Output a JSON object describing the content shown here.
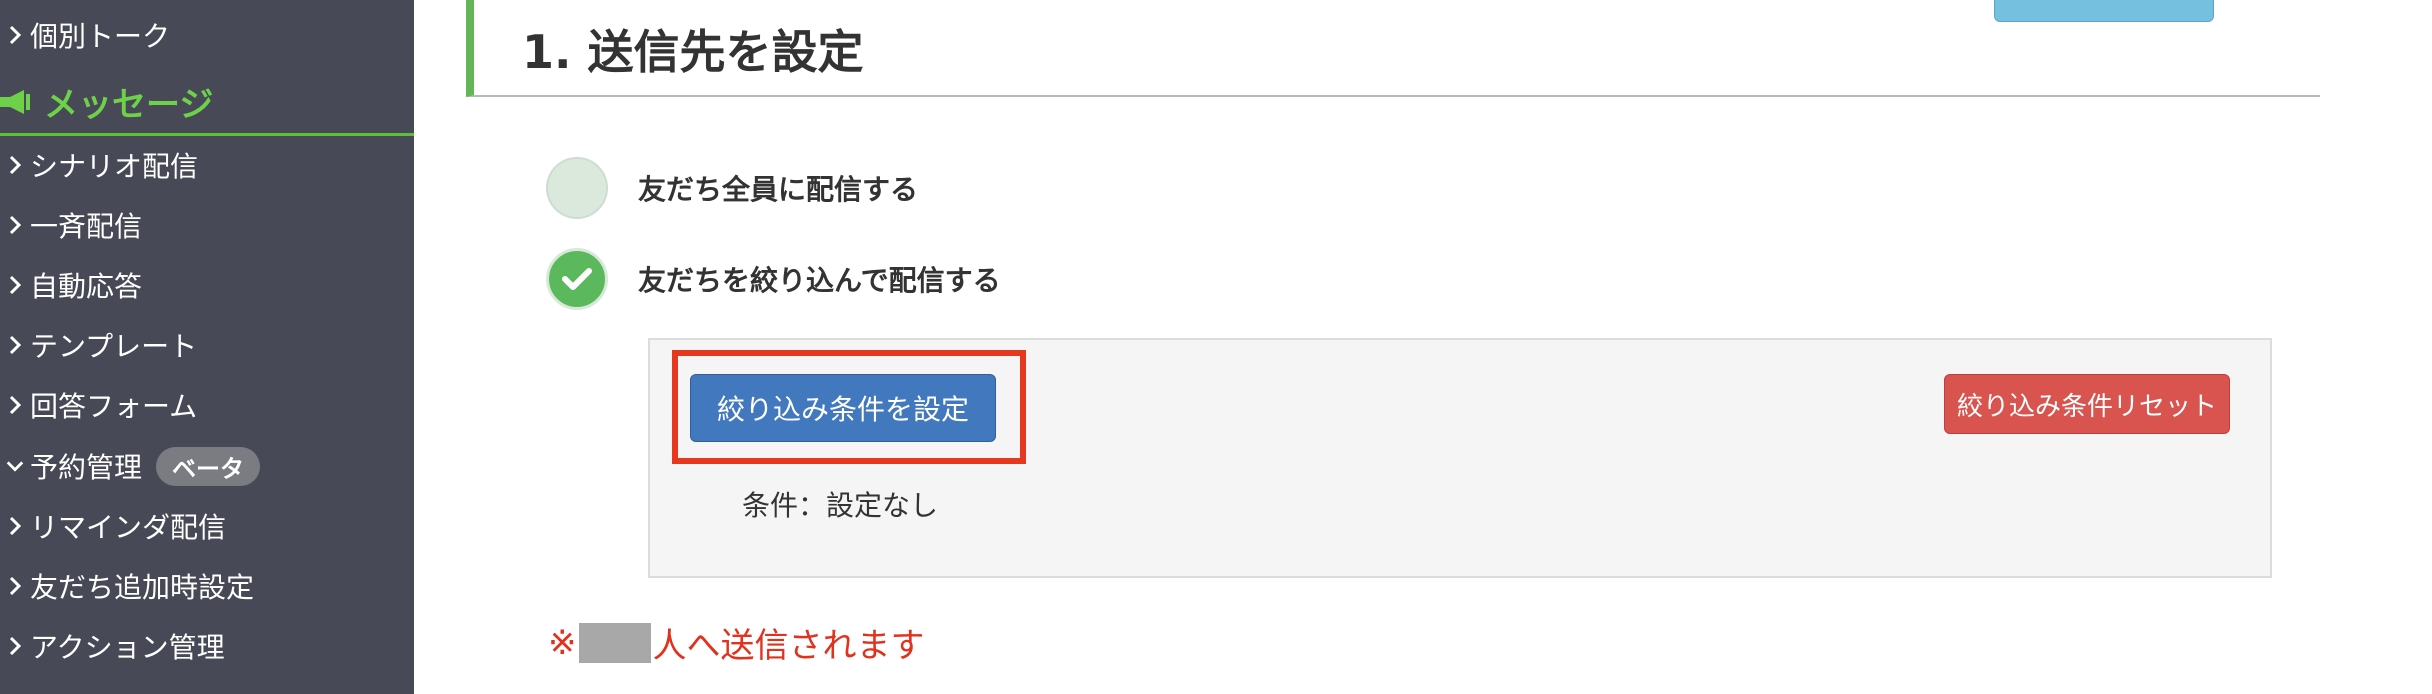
{
  "sidebar": {
    "items_top": [
      {
        "label": "個別トーク"
      }
    ],
    "section": {
      "label": "メッセージ",
      "icon": "megaphone-icon",
      "color": "#6ed14a"
    },
    "items": [
      {
        "label": "シナリオ配信",
        "chevron": "right"
      },
      {
        "label": "一斉配信",
        "chevron": "right"
      },
      {
        "label": "自動応答",
        "chevron": "right"
      },
      {
        "label": "テンプレート",
        "chevron": "right"
      },
      {
        "label": "回答フォーム",
        "chevron": "right"
      },
      {
        "label": "予約管理",
        "chevron": "down",
        "badge": "ベータ"
      },
      {
        "label": "リマインダ配信",
        "chevron": "right"
      },
      {
        "label": "友だち追加時設定",
        "chevron": "right"
      },
      {
        "label": "アクション管理",
        "chevron": "right"
      }
    ]
  },
  "main": {
    "section_title": "1. 送信先を設定",
    "options": [
      {
        "label": "友だち全員に配信する",
        "selected": false
      },
      {
        "label": "友だちを絞り込んで配信する",
        "selected": true
      }
    ],
    "filter": {
      "set_button": "絞り込み条件を設定",
      "reset_button": "絞り込み条件リセット",
      "condition_text": "条件：設定なし"
    },
    "send_note": {
      "prefix": "※",
      "suffix": "人へ送信されます"
    }
  },
  "colors": {
    "sidebar_bg": "#474a56",
    "accent_green": "#5cb85c",
    "primary_button": "#4178be",
    "danger_button": "#d9534f",
    "highlight_box": "#e5381f",
    "note_red": "#e0321e"
  }
}
